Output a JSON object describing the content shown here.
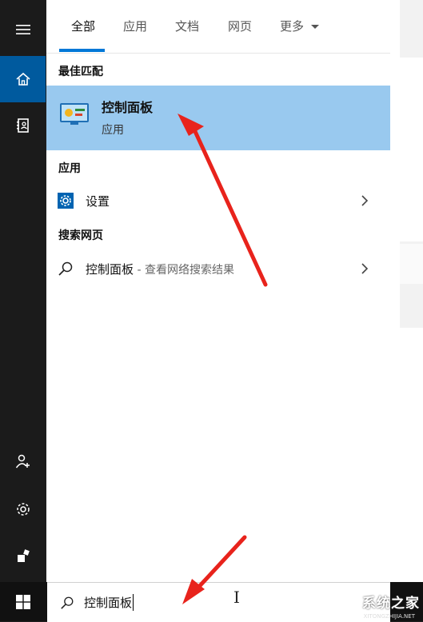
{
  "tabs": [
    {
      "label": "全部",
      "active": true
    },
    {
      "label": "应用",
      "active": false
    },
    {
      "label": "文档",
      "active": false
    },
    {
      "label": "网页",
      "active": false
    },
    {
      "label": "更多",
      "active": false
    }
  ],
  "sections": {
    "best_match": "最佳匹配",
    "apps": "应用",
    "web": "搜索网页"
  },
  "best_match": {
    "title": "控制面板",
    "subtitle": "应用",
    "icon": "control-panel-icon"
  },
  "app_results": [
    {
      "label": "设置",
      "icon": "settings-gear-icon"
    }
  ],
  "web_results": [
    {
      "label": "控制面板",
      "sublabel": " - 查看网络搜索结果",
      "icon": "search-icon"
    }
  ],
  "search": {
    "value": "控制面板"
  },
  "rail": [
    {
      "name": "menu",
      "icon": "hamburger-icon",
      "active": false
    },
    {
      "name": "home",
      "icon": "home-icon",
      "active": true
    },
    {
      "name": "notebook",
      "icon": "notebook-icon",
      "active": false
    },
    {
      "name": "feedback",
      "icon": "add-person-icon",
      "active": false
    },
    {
      "name": "settings",
      "icon": "gear-icon",
      "active": false
    },
    {
      "name": "user",
      "icon": "user-icon",
      "active": false
    }
  ],
  "watermark": {
    "text": "系统之家",
    "url": "XITONGZHIJIA.NET"
  },
  "colors": {
    "accent": "#0078d7",
    "selected_bg": "#99c9ef",
    "rail_active": "#005a9e",
    "annotation_arrow": "#e8231c"
  }
}
